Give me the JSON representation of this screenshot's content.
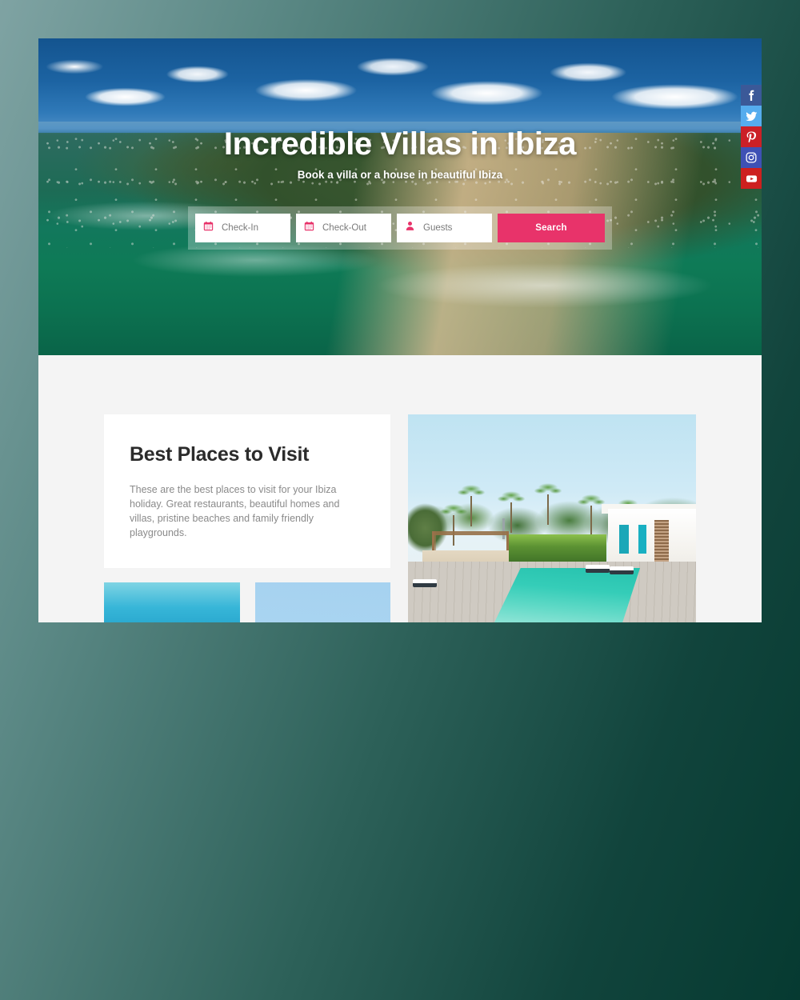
{
  "site": {
    "accent_color": "#e8336a",
    "content_bg": "#f4f4f4",
    "page_bg_gradient_from": "#7fa3a3",
    "page_bg_gradient_to": "#063a31"
  },
  "hero": {
    "title": "Incredible Villas in Ibiza",
    "subtitle": "Book a villa or a house in beautiful Ibiza",
    "image_alt": "Aerial view of a coastal town with beach and turquoise ocean"
  },
  "search": {
    "checkin": {
      "icon": "calendar-icon",
      "placeholder": "Check-In",
      "value": ""
    },
    "checkout": {
      "icon": "calendar-icon",
      "placeholder": "Check-Out",
      "value": ""
    },
    "guests": {
      "icon": "person-icon",
      "placeholder": "Guests",
      "value": ""
    },
    "submit_label": "Search"
  },
  "social": [
    {
      "name": "facebook",
      "icon": "facebook-icon",
      "color": "#3b5998",
      "glyph": "f"
    },
    {
      "name": "twitter",
      "icon": "twitter-icon",
      "color": "#55acee",
      "glyph": "t"
    },
    {
      "name": "pinterest",
      "icon": "pinterest-icon",
      "color": "#cb2027",
      "glyph": "p"
    },
    {
      "name": "instagram",
      "icon": "instagram-icon",
      "color": "#3f51b5",
      "glyph": "ig"
    },
    {
      "name": "youtube",
      "icon": "youtube-icon",
      "color": "#cd201f",
      "glyph": "yt"
    }
  ],
  "best_places": {
    "heading": "Best Places to Visit",
    "body": "These are the best places to visit for your Ibiza holiday. Great restaurants, beautiful homes and villas, pristine beaches and family friendly playgrounds."
  },
  "thumbnails": [
    {
      "id": "sea-view-terrace",
      "alt": "White terrace frame looking out over a turquoise sea"
    },
    {
      "id": "blue-sky",
      "alt": "Clear light blue sky"
    }
  ],
  "feature_image": {
    "id": "villa-pool",
    "alt": "Modern white villa with a long turquoise swimming pool and palm trees"
  }
}
